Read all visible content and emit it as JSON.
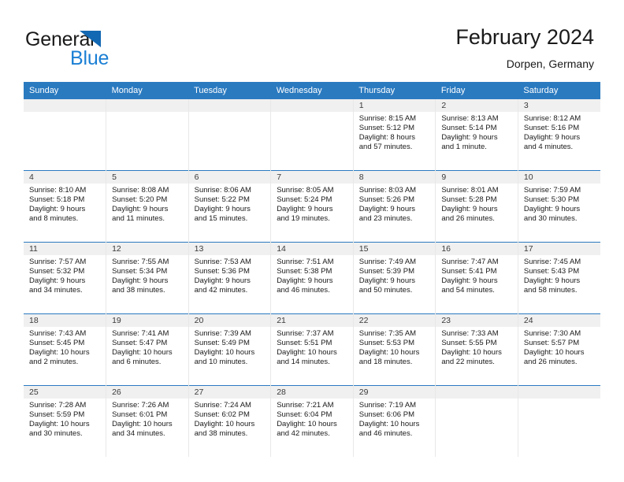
{
  "brand": {
    "name_part1": "General",
    "name_part2": "Blue",
    "logo_icon": "triangle-flag-icon",
    "accent_color": "#1268b3",
    "blue_text_color": "#1a7fd4"
  },
  "header": {
    "title": "February 2024",
    "subtitle": "Dorpen, Germany"
  },
  "theme": {
    "header_blue": "#2a7ac0",
    "date_band_gray": "#f0f0f0",
    "text_color": "#1a1a1a"
  },
  "calendar": {
    "day_headers": [
      "Sunday",
      "Monday",
      "Tuesday",
      "Wednesday",
      "Thursday",
      "Friday",
      "Saturday"
    ],
    "weeks": [
      [
        {
          "day": "",
          "sunrise": "",
          "sunset": "",
          "daylight_line1": "",
          "daylight_line2": ""
        },
        {
          "day": "",
          "sunrise": "",
          "sunset": "",
          "daylight_line1": "",
          "daylight_line2": ""
        },
        {
          "day": "",
          "sunrise": "",
          "sunset": "",
          "daylight_line1": "",
          "daylight_line2": ""
        },
        {
          "day": "",
          "sunrise": "",
          "sunset": "",
          "daylight_line1": "",
          "daylight_line2": ""
        },
        {
          "day": "1",
          "sunrise": "Sunrise: 8:15 AM",
          "sunset": "Sunset: 5:12 PM",
          "daylight_line1": "Daylight: 8 hours",
          "daylight_line2": "and 57 minutes."
        },
        {
          "day": "2",
          "sunrise": "Sunrise: 8:13 AM",
          "sunset": "Sunset: 5:14 PM",
          "daylight_line1": "Daylight: 9 hours",
          "daylight_line2": "and 1 minute."
        },
        {
          "day": "3",
          "sunrise": "Sunrise: 8:12 AM",
          "sunset": "Sunset: 5:16 PM",
          "daylight_line1": "Daylight: 9 hours",
          "daylight_line2": "and 4 minutes."
        }
      ],
      [
        {
          "day": "4",
          "sunrise": "Sunrise: 8:10 AM",
          "sunset": "Sunset: 5:18 PM",
          "daylight_line1": "Daylight: 9 hours",
          "daylight_line2": "and 8 minutes."
        },
        {
          "day": "5",
          "sunrise": "Sunrise: 8:08 AM",
          "sunset": "Sunset: 5:20 PM",
          "daylight_line1": "Daylight: 9 hours",
          "daylight_line2": "and 11 minutes."
        },
        {
          "day": "6",
          "sunrise": "Sunrise: 8:06 AM",
          "sunset": "Sunset: 5:22 PM",
          "daylight_line1": "Daylight: 9 hours",
          "daylight_line2": "and 15 minutes."
        },
        {
          "day": "7",
          "sunrise": "Sunrise: 8:05 AM",
          "sunset": "Sunset: 5:24 PM",
          "daylight_line1": "Daylight: 9 hours",
          "daylight_line2": "and 19 minutes."
        },
        {
          "day": "8",
          "sunrise": "Sunrise: 8:03 AM",
          "sunset": "Sunset: 5:26 PM",
          "daylight_line1": "Daylight: 9 hours",
          "daylight_line2": "and 23 minutes."
        },
        {
          "day": "9",
          "sunrise": "Sunrise: 8:01 AM",
          "sunset": "Sunset: 5:28 PM",
          "daylight_line1": "Daylight: 9 hours",
          "daylight_line2": "and 26 minutes."
        },
        {
          "day": "10",
          "sunrise": "Sunrise: 7:59 AM",
          "sunset": "Sunset: 5:30 PM",
          "daylight_line1": "Daylight: 9 hours",
          "daylight_line2": "and 30 minutes."
        }
      ],
      [
        {
          "day": "11",
          "sunrise": "Sunrise: 7:57 AM",
          "sunset": "Sunset: 5:32 PM",
          "daylight_line1": "Daylight: 9 hours",
          "daylight_line2": "and 34 minutes."
        },
        {
          "day": "12",
          "sunrise": "Sunrise: 7:55 AM",
          "sunset": "Sunset: 5:34 PM",
          "daylight_line1": "Daylight: 9 hours",
          "daylight_line2": "and 38 minutes."
        },
        {
          "day": "13",
          "sunrise": "Sunrise: 7:53 AM",
          "sunset": "Sunset: 5:36 PM",
          "daylight_line1": "Daylight: 9 hours",
          "daylight_line2": "and 42 minutes."
        },
        {
          "day": "14",
          "sunrise": "Sunrise: 7:51 AM",
          "sunset": "Sunset: 5:38 PM",
          "daylight_line1": "Daylight: 9 hours",
          "daylight_line2": "and 46 minutes."
        },
        {
          "day": "15",
          "sunrise": "Sunrise: 7:49 AM",
          "sunset": "Sunset: 5:39 PM",
          "daylight_line1": "Daylight: 9 hours",
          "daylight_line2": "and 50 minutes."
        },
        {
          "day": "16",
          "sunrise": "Sunrise: 7:47 AM",
          "sunset": "Sunset: 5:41 PM",
          "daylight_line1": "Daylight: 9 hours",
          "daylight_line2": "and 54 minutes."
        },
        {
          "day": "17",
          "sunrise": "Sunrise: 7:45 AM",
          "sunset": "Sunset: 5:43 PM",
          "daylight_line1": "Daylight: 9 hours",
          "daylight_line2": "and 58 minutes."
        }
      ],
      [
        {
          "day": "18",
          "sunrise": "Sunrise: 7:43 AM",
          "sunset": "Sunset: 5:45 PM",
          "daylight_line1": "Daylight: 10 hours",
          "daylight_line2": "and 2 minutes."
        },
        {
          "day": "19",
          "sunrise": "Sunrise: 7:41 AM",
          "sunset": "Sunset: 5:47 PM",
          "daylight_line1": "Daylight: 10 hours",
          "daylight_line2": "and 6 minutes."
        },
        {
          "day": "20",
          "sunrise": "Sunrise: 7:39 AM",
          "sunset": "Sunset: 5:49 PM",
          "daylight_line1": "Daylight: 10 hours",
          "daylight_line2": "and 10 minutes."
        },
        {
          "day": "21",
          "sunrise": "Sunrise: 7:37 AM",
          "sunset": "Sunset: 5:51 PM",
          "daylight_line1": "Daylight: 10 hours",
          "daylight_line2": "and 14 minutes."
        },
        {
          "day": "22",
          "sunrise": "Sunrise: 7:35 AM",
          "sunset": "Sunset: 5:53 PM",
          "daylight_line1": "Daylight: 10 hours",
          "daylight_line2": "and 18 minutes."
        },
        {
          "day": "23",
          "sunrise": "Sunrise: 7:33 AM",
          "sunset": "Sunset: 5:55 PM",
          "daylight_line1": "Daylight: 10 hours",
          "daylight_line2": "and 22 minutes."
        },
        {
          "day": "24",
          "sunrise": "Sunrise: 7:30 AM",
          "sunset": "Sunset: 5:57 PM",
          "daylight_line1": "Daylight: 10 hours",
          "daylight_line2": "and 26 minutes."
        }
      ],
      [
        {
          "day": "25",
          "sunrise": "Sunrise: 7:28 AM",
          "sunset": "Sunset: 5:59 PM",
          "daylight_line1": "Daylight: 10 hours",
          "daylight_line2": "and 30 minutes."
        },
        {
          "day": "26",
          "sunrise": "Sunrise: 7:26 AM",
          "sunset": "Sunset: 6:01 PM",
          "daylight_line1": "Daylight: 10 hours",
          "daylight_line2": "and 34 minutes."
        },
        {
          "day": "27",
          "sunrise": "Sunrise: 7:24 AM",
          "sunset": "Sunset: 6:02 PM",
          "daylight_line1": "Daylight: 10 hours",
          "daylight_line2": "and 38 minutes."
        },
        {
          "day": "28",
          "sunrise": "Sunrise: 7:21 AM",
          "sunset": "Sunset: 6:04 PM",
          "daylight_line1": "Daylight: 10 hours",
          "daylight_line2": "and 42 minutes."
        },
        {
          "day": "29",
          "sunrise": "Sunrise: 7:19 AM",
          "sunset": "Sunset: 6:06 PM",
          "daylight_line1": "Daylight: 10 hours",
          "daylight_line2": "and 46 minutes."
        },
        {
          "day": "",
          "sunrise": "",
          "sunset": "",
          "daylight_line1": "",
          "daylight_line2": ""
        },
        {
          "day": "",
          "sunrise": "",
          "sunset": "",
          "daylight_line1": "",
          "daylight_line2": ""
        }
      ]
    ]
  }
}
